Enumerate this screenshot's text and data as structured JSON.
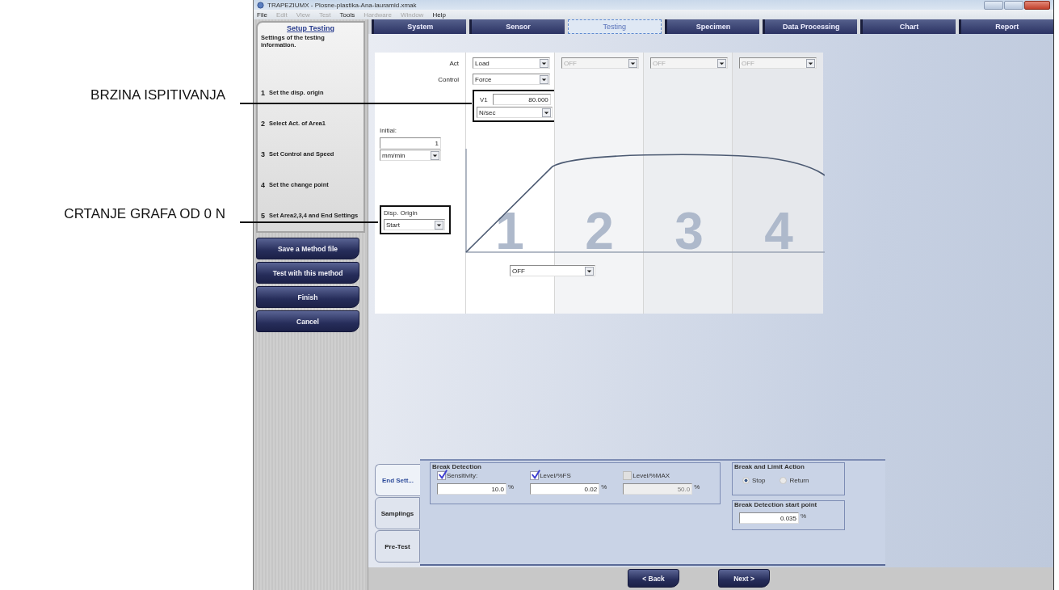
{
  "annotations": [
    {
      "text": "BRZINA ISPITIVANJA"
    },
    {
      "text": "CRTANJE GRAFA OD 0 N"
    }
  ],
  "window": {
    "title": "TRAPEZIUMX - Plosne-plastika-Ana-lauramid.xmak"
  },
  "menu": [
    {
      "label": "File",
      "disabled": false
    },
    {
      "label": "Edit",
      "disabled": true
    },
    {
      "label": "View",
      "disabled": true
    },
    {
      "label": "Test",
      "disabled": true
    },
    {
      "label": "Tools",
      "disabled": false
    },
    {
      "label": "Hardware",
      "disabled": true
    },
    {
      "label": "Window",
      "disabled": true
    },
    {
      "label": "Help",
      "disabled": false
    }
  ],
  "sidebar": {
    "title": "Setup Testing",
    "description": "Settings of the testing information.",
    "steps": [
      {
        "number": "1",
        "label": "Set the disp. origin"
      },
      {
        "number": "2",
        "label": "Select Act. of Area1"
      },
      {
        "number": "3",
        "label": "Set Control and Speed"
      },
      {
        "number": "4",
        "label": "Set the change point"
      },
      {
        "number": "5",
        "label": "Set Area2,3,4 and End Settings"
      }
    ],
    "buttons": [
      "Save a Method file",
      "Test with this method",
      "Finish",
      "Cancel"
    ]
  },
  "tabs": [
    {
      "label": "System",
      "selected": false
    },
    {
      "label": "Sensor",
      "selected": false
    },
    {
      "label": "Testing",
      "selected": true
    },
    {
      "label": "Specimen",
      "selected": false
    },
    {
      "label": "Data Processing",
      "selected": false
    },
    {
      "label": "Chart",
      "selected": false
    },
    {
      "label": "Report",
      "selected": false
    }
  ],
  "act": {
    "label": "Act",
    "areas": [
      {
        "value": "Load",
        "disabled": false
      },
      {
        "value": "OFF",
        "disabled": true
      },
      {
        "value": "OFF",
        "disabled": true
      },
      {
        "value": "OFF",
        "disabled": true
      }
    ]
  },
  "control": {
    "label": "Control",
    "value": "Force"
  },
  "speed": {
    "label": "V1",
    "value": "80.000",
    "unit": "N/sec"
  },
  "initial": {
    "label": "Initial:",
    "value": "1",
    "unit": "mm/min"
  },
  "disp_origin": {
    "label": "Disp. Origin",
    "value": "Start"
  },
  "area_numbers": [
    "1",
    "2",
    "3",
    "4"
  ],
  "change_point": {
    "value": "OFF"
  },
  "end_tabs": [
    {
      "label": "End Sett...",
      "selected": true
    },
    {
      "label": "Samplings",
      "selected": false
    },
    {
      "label": "Pre-Test",
      "selected": false
    }
  ],
  "break_detection": {
    "title": "Break Detection",
    "items": [
      {
        "label": "Sensitivity:",
        "checked": true,
        "disabled": false,
        "value": "10.0",
        "unit": "%"
      },
      {
        "label": "Level/%FS",
        "checked": true,
        "disabled": false,
        "value": "0.02",
        "unit": "%"
      },
      {
        "label": "Level/%MAX",
        "checked": false,
        "disabled": true,
        "value": "50.0",
        "unit": "%"
      }
    ]
  },
  "break_action": {
    "title": "Break and Limit Action",
    "options": [
      {
        "label": "Stop",
        "selected": true
      },
      {
        "label": "Return",
        "selected": false
      }
    ]
  },
  "break_start": {
    "title": "Break Detection start point",
    "value": "0.035",
    "unit": "%"
  },
  "nav_buttons": [
    "< Back",
    "Next >"
  ]
}
